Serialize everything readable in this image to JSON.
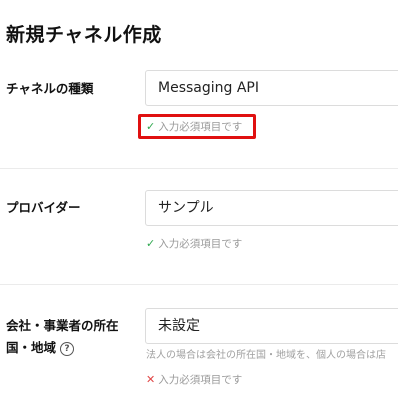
{
  "page": {
    "title": "新規チャネル作成"
  },
  "fields": [
    {
      "label": "チャネルの種類",
      "value": "Messaging API",
      "validation": {
        "icon": "check-icon",
        "text": "入力必須項目です",
        "status": "valid"
      }
    },
    {
      "label": "プロバイダー",
      "value": "サンプル",
      "validation": {
        "icon": "check-icon",
        "text": "入力必須項目です",
        "status": "valid"
      }
    },
    {
      "label_line1": "会社・事業者の所在",
      "label_line2": "国・地域",
      "help_icon": "?",
      "value": "未設定",
      "hint": "法人の場合は会社の所在国・地域を、個人の場合は店",
      "validation": {
        "icon": "error-icon",
        "text": "入力必須項目です",
        "status": "invalid"
      }
    }
  ],
  "colors": {
    "valid": "#2fa84f",
    "invalid": "#e04545",
    "highlight": "#e01010"
  }
}
